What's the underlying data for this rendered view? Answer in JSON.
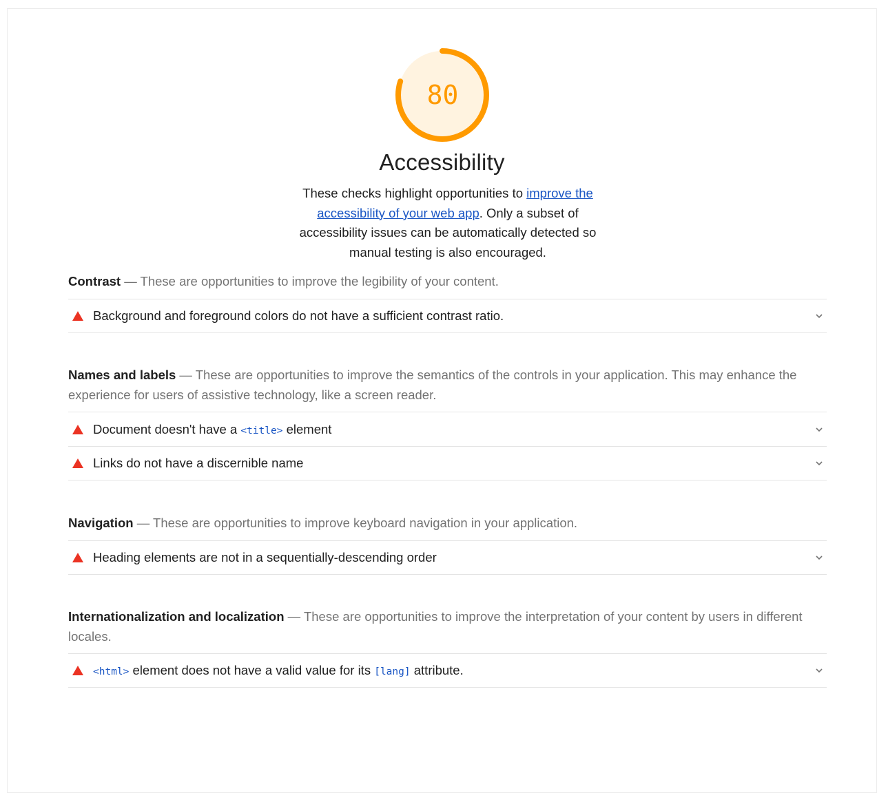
{
  "score": {
    "value": "80",
    "fraction": 0.8,
    "color": "#ff9a00",
    "background": "#fff3e0"
  },
  "category": {
    "title": "Accessibility",
    "description_prefix": "These checks highlight opportunities to ",
    "link_text": "improve the accessibility of your web app",
    "description_suffix": ". Only a subset of accessibility issues can be automatically detected so manual testing is also encouraged."
  },
  "groups": [
    {
      "title": "Contrast",
      "separator": " — ",
      "description": "These are opportunities to improve the legibility of your content.",
      "audits": [
        {
          "title": "Background and foreground colors do not have a sufficient contrast ratio."
        }
      ]
    },
    {
      "title": "Names and labels",
      "separator": " — ",
      "description": "These are opportunities to improve the semantics of the controls in your application. This may enhance the experience for users of assistive technology, like a screen reader.",
      "audits": [
        {
          "prefix": "Document doesn't have a ",
          "code": "<title>",
          "suffix": " element"
        },
        {
          "title": "Links do not have a discernible name"
        }
      ]
    },
    {
      "title": "Navigation",
      "separator": " — ",
      "description": "These are opportunities to improve keyboard navigation in your application.",
      "audits": [
        {
          "title": "Heading elements are not in a sequentially-descending order"
        }
      ]
    },
    {
      "title": "Internationalization and localization",
      "separator": " — ",
      "description": "These are opportunities to improve the interpretation of your content by users in different locales.",
      "audits": [
        {
          "code": "<html>",
          "middle": " element does not have a valid value for its ",
          "code2": "[lang]",
          "suffix": " attribute."
        }
      ]
    }
  ],
  "icons": {
    "fail": "fail-triangle-icon",
    "expand": "chevron-down-icon"
  },
  "colors": {
    "fail": "#eb3323",
    "link": "#1a56c4",
    "muted": "#737373"
  }
}
